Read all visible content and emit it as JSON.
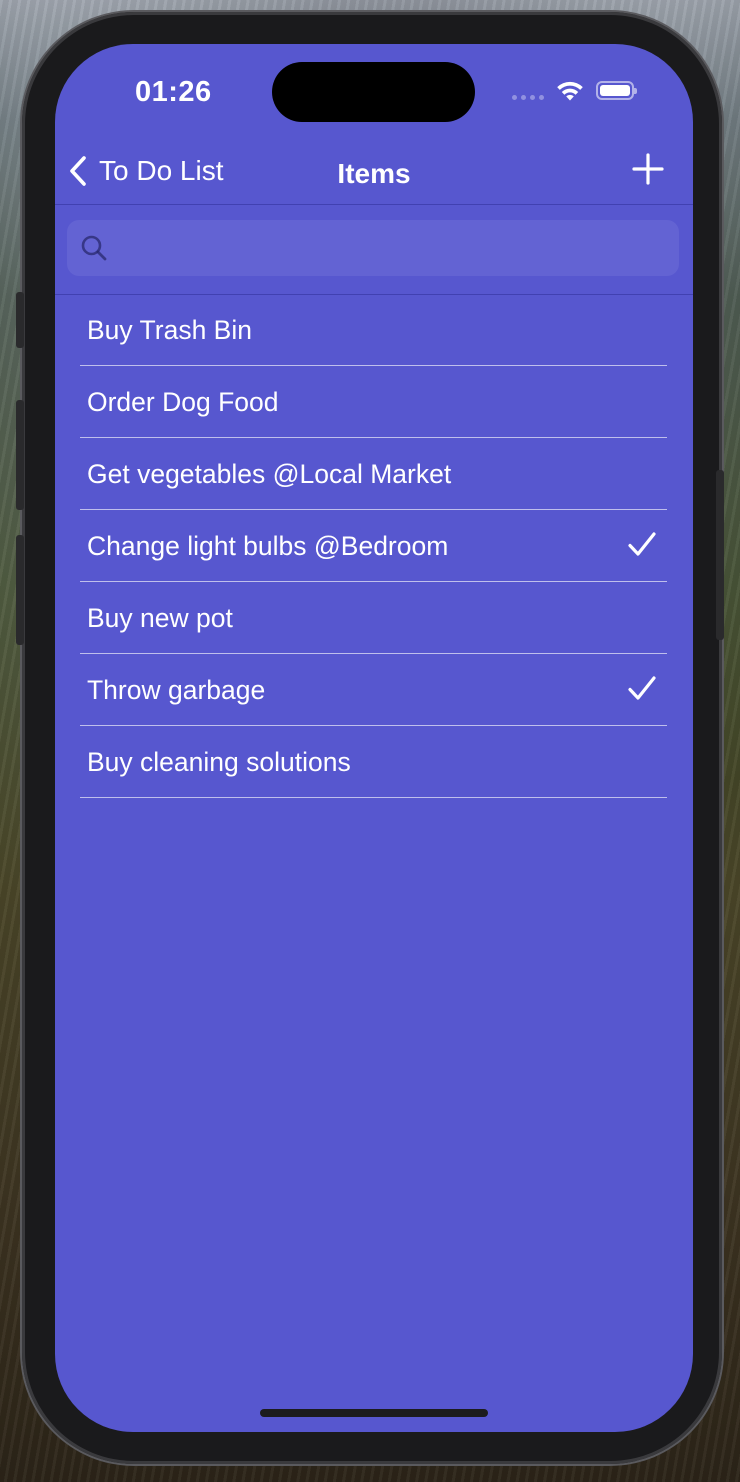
{
  "status_bar": {
    "time": "01:26"
  },
  "nav": {
    "back_label": "To Do List",
    "title": "Items",
    "add_icon": "plus-icon"
  },
  "search": {
    "placeholder": "",
    "value": ""
  },
  "items": [
    {
      "label": "Buy Trash Bin",
      "done": false
    },
    {
      "label": "Order Dog Food",
      "done": false
    },
    {
      "label": "Get vegetables @Local Market",
      "done": false
    },
    {
      "label": "Change light bulbs @Bedroom",
      "done": true
    },
    {
      "label": "Buy new pot",
      "done": false
    },
    {
      "label": "Throw garbage",
      "done": true
    },
    {
      "label": "Buy cleaning solutions",
      "done": false
    }
  ],
  "colors": {
    "background": "#5757cf",
    "text": "#ffffff",
    "separator": "#e1e1f5"
  }
}
